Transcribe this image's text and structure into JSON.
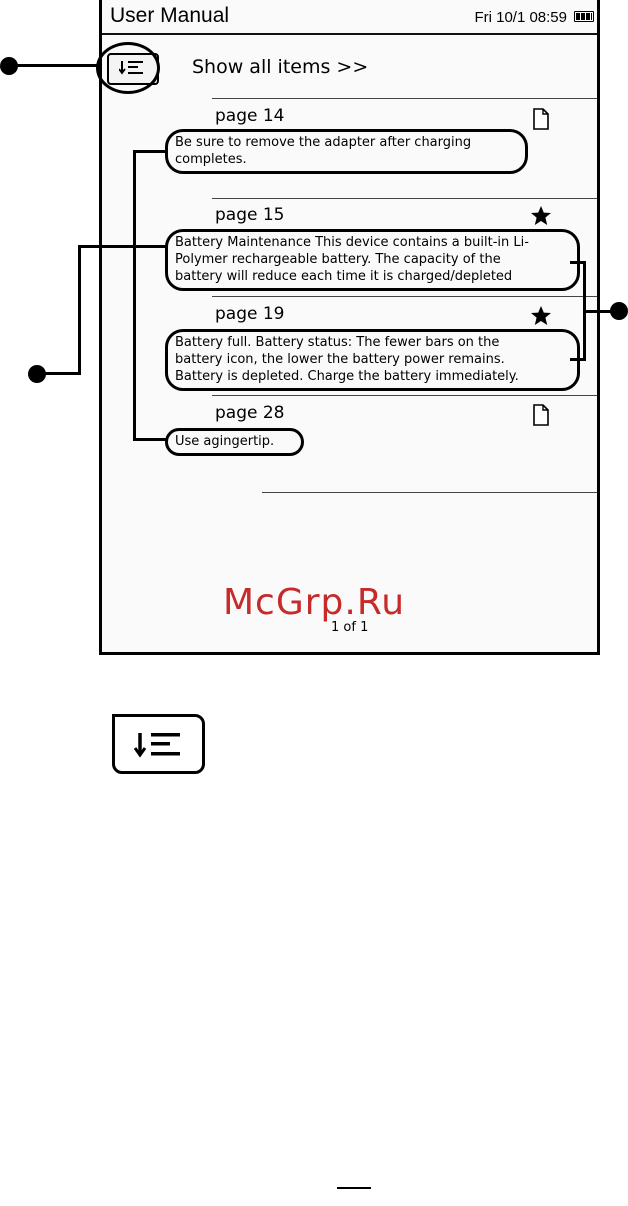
{
  "header": {
    "title": "User Manual",
    "datetime": "Fri 10/1 08:59",
    "battery_icon": "battery-full-icon"
  },
  "toolbar": {
    "sort_icon": "sort-list-icon",
    "show_all_label": "Show all items >>"
  },
  "items": [
    {
      "page": "page 14",
      "text": [
        "Be sure to remove the adapter after charging",
        "completes."
      ],
      "icon": "note-page-icon"
    },
    {
      "page": "page 15",
      "text": [
        "Battery Maintenance This device contains a built-in Li-",
        "Polymer rechargeable battery. The capacity of the",
        "battery will reduce each time it is charged/depleted"
      ],
      "icon": "star-icon"
    },
    {
      "page": "page 19",
      "text": [
        "Battery full. Battery status: The fewer bars on the",
        "battery icon, the lower the battery power remains.",
        "Battery is depleted. Charge the battery immediately."
      ],
      "icon": "star-icon"
    },
    {
      "page": "page 28",
      "text": [
        "Use agingertip."
      ],
      "icon": "note-page-icon"
    }
  ],
  "footer": {
    "pagination": "1 of 1",
    "watermark": "McGrp.Ru"
  },
  "colors": {
    "watermark": "#c72a2a",
    "ink": "#000000",
    "screen_bg": "#fafafa"
  }
}
